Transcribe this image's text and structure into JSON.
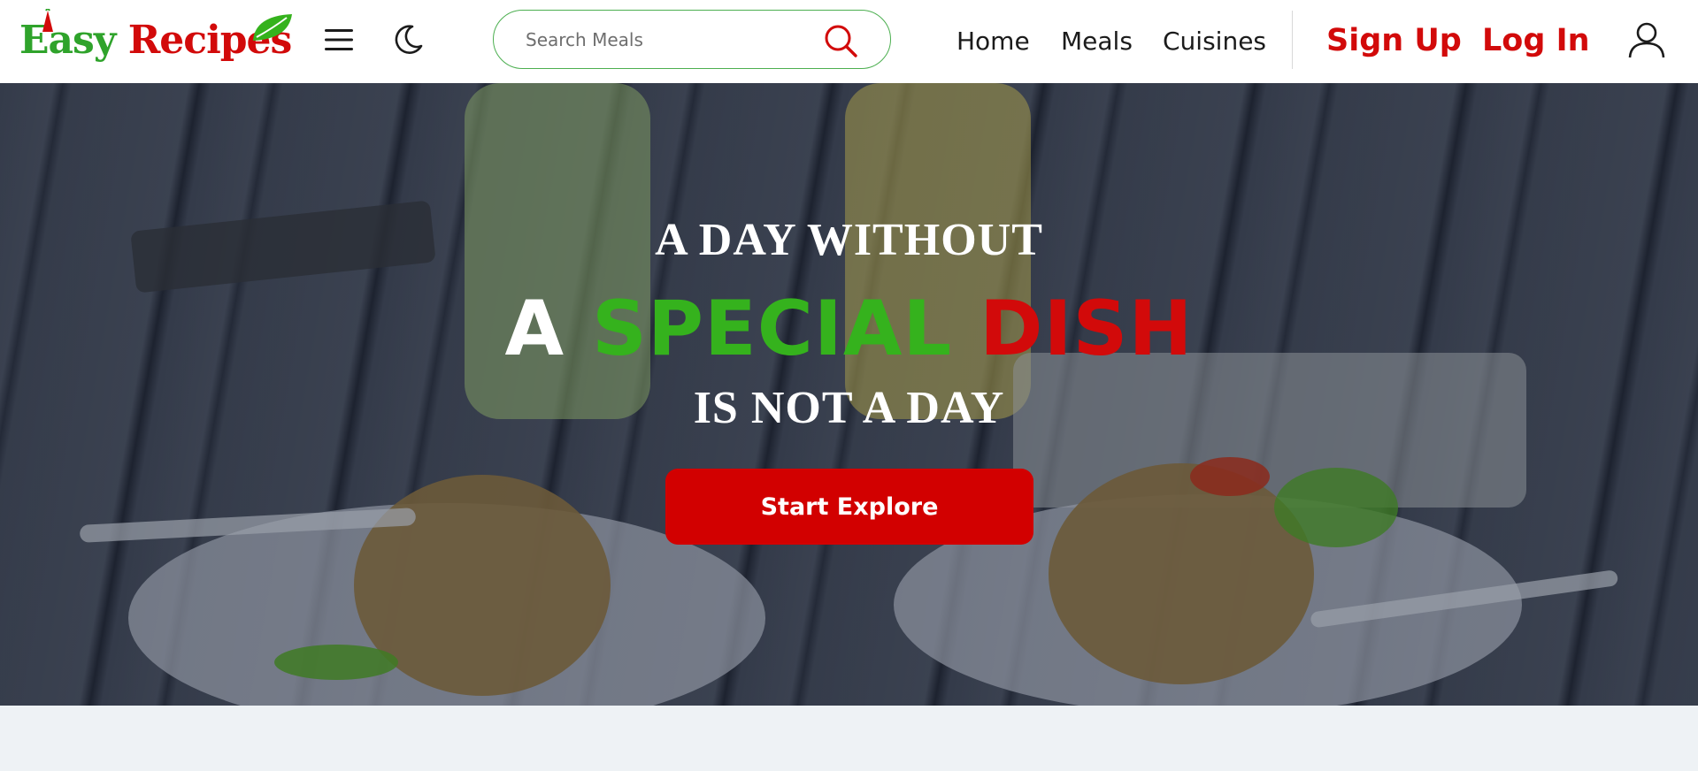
{
  "brand": {
    "part1": "Easy",
    "part2": "Recipes",
    "colors": {
      "green": "#2fa32b",
      "red": "#d20a0a"
    }
  },
  "header": {
    "menu_icon": "hamburger-menu-icon",
    "theme_icon": "moon-icon",
    "search": {
      "placeholder": "Search Meals",
      "value": "",
      "icon": "search-icon"
    },
    "nav": [
      {
        "label": "Home"
      },
      {
        "label": "Meals"
      },
      {
        "label": "Cuisines"
      }
    ],
    "signup_label": "Sign Up",
    "login_label": "Log In",
    "user_icon": "user-icon"
  },
  "hero": {
    "line1": "A DAY WITHOUT",
    "line2_word1": "A",
    "line2_word2": "SPECIAL",
    "line2_word3": "DISH",
    "line3": "IS NOT A DAY",
    "cta_label": "Start Explore",
    "colors": {
      "accent_green": "#35b21d",
      "accent_red": "#d20a0a",
      "button": "#d20000"
    }
  }
}
